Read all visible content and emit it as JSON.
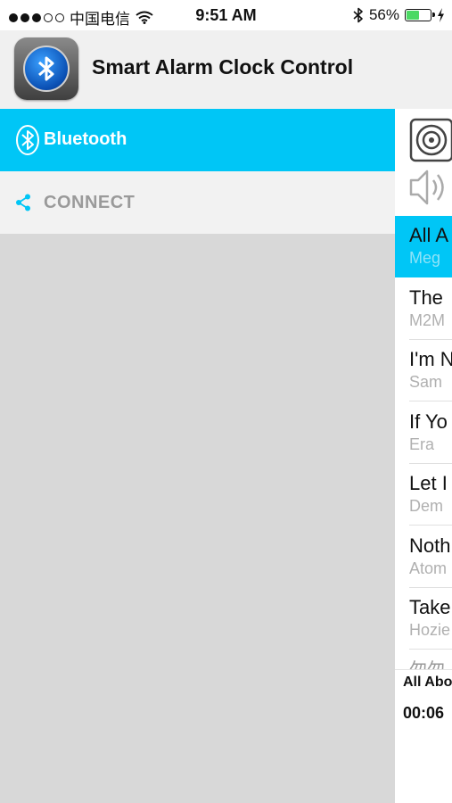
{
  "status_bar": {
    "signal_dots_filled": 3,
    "signal_dots_empty": 2,
    "carrier": "中国电信",
    "time": "9:51 AM",
    "battery_percent": "56%",
    "battery_level": 0.56,
    "battery_color": "#4cd964"
  },
  "header": {
    "app_title": "Smart Alarm Clock Control",
    "app_icon": "bluetooth-app-icon"
  },
  "drawer": {
    "accent_color": "#00c6f6",
    "bluetooth_label": "Bluetooth",
    "connect_label": "CONNECT"
  },
  "player_panel": {
    "toolbar_icons": [
      "speaker-device-icon",
      "volume-icon"
    ],
    "tracks": [
      {
        "title": "All A",
        "artist": "Meg",
        "active": true
      },
      {
        "title": "The",
        "artist": "M2M",
        "active": false
      },
      {
        "title": "I'm N",
        "artist": "Sam",
        "active": false
      },
      {
        "title": "If Yo",
        "artist": "Era",
        "active": false
      },
      {
        "title": "Let I",
        "artist": "Dem",
        "active": false
      },
      {
        "title": "Noth",
        "artist": "Atom",
        "active": false
      },
      {
        "title": "Take",
        "artist": "Hozie",
        "active": false
      }
    ],
    "partial_track_title": "勿勿",
    "now_playing": "All Abo",
    "elapsed_time": "00:06"
  }
}
